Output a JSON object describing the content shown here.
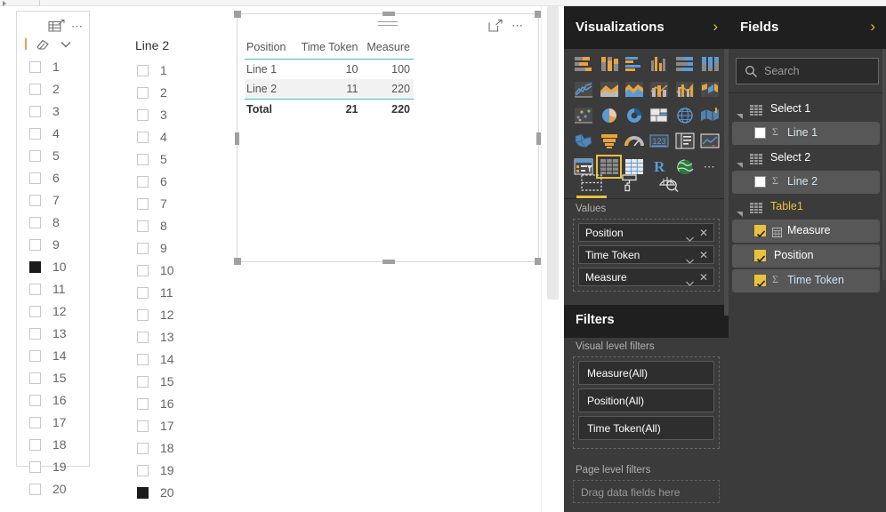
{
  "slicer1": {
    "icons": {
      "focus": "focus-mode-icon",
      "menu": "more-options-icon",
      "eraser": "clear-selections-icon",
      "chevron": "chevron-down-icon"
    },
    "items": [
      {
        "label": "1",
        "checked": false
      },
      {
        "label": "2",
        "checked": false
      },
      {
        "label": "3",
        "checked": false
      },
      {
        "label": "4",
        "checked": false
      },
      {
        "label": "5",
        "checked": false
      },
      {
        "label": "6",
        "checked": false
      },
      {
        "label": "7",
        "checked": false
      },
      {
        "label": "8",
        "checked": false
      },
      {
        "label": "9",
        "checked": false
      },
      {
        "label": "10",
        "checked": true
      },
      {
        "label": "11",
        "checked": false
      },
      {
        "label": "12",
        "checked": false
      },
      {
        "label": "13",
        "checked": false
      },
      {
        "label": "14",
        "checked": false
      },
      {
        "label": "15",
        "checked": false
      },
      {
        "label": "16",
        "checked": false
      },
      {
        "label": "17",
        "checked": false
      },
      {
        "label": "18",
        "checked": false
      },
      {
        "label": "19",
        "checked": false
      },
      {
        "label": "20",
        "checked": false
      }
    ]
  },
  "slicer2": {
    "title": "Line 2",
    "items": [
      {
        "label": "1",
        "checked": false
      },
      {
        "label": "2",
        "checked": false
      },
      {
        "label": "3",
        "checked": false
      },
      {
        "label": "4",
        "checked": false
      },
      {
        "label": "5",
        "checked": false
      },
      {
        "label": "6",
        "checked": false
      },
      {
        "label": "7",
        "checked": false
      },
      {
        "label": "8",
        "checked": false
      },
      {
        "label": "9",
        "checked": false
      },
      {
        "label": "10",
        "checked": false
      },
      {
        "label": "11",
        "checked": false
      },
      {
        "label": "12",
        "checked": false
      },
      {
        "label": "13",
        "checked": false
      },
      {
        "label": "14",
        "checked": false
      },
      {
        "label": "15",
        "checked": false
      },
      {
        "label": "16",
        "checked": false
      },
      {
        "label": "17",
        "checked": false
      },
      {
        "label": "18",
        "checked": false
      },
      {
        "label": "19",
        "checked": false
      },
      {
        "label": "20",
        "checked": true
      }
    ]
  },
  "visual": {
    "icons": {
      "grip": "drag-grip-icon",
      "focus": "focus-mode-icon",
      "menu": "more-options-icon"
    },
    "table": {
      "headers": [
        "Position",
        "Time Token",
        "Measure"
      ],
      "rows": [
        [
          "Line 1",
          "10",
          "100"
        ],
        [
          "Line 2",
          "11",
          "220"
        ]
      ],
      "total": [
        "Total",
        "21",
        "220"
      ]
    }
  },
  "visualizations": {
    "title": "Visualizations",
    "expand_icon": "chevron-right-icon",
    "icons": [
      [
        "stacked-bar-chart-icon",
        "stacked-column-chart-icon",
        "clustered-bar-chart-icon",
        "clustered-column-chart-icon",
        "hundred-percent-stacked-bar-icon",
        "hundred-percent-stacked-column-icon"
      ],
      [
        "line-chart-icon",
        "area-chart-icon",
        "stacked-area-chart-icon",
        "line-stacked-column-icon",
        "line-clustered-column-icon",
        "ribbon-chart-icon"
      ],
      [
        "scatter-chart-icon",
        "pie-chart-icon",
        "donut-chart-icon",
        "treemap-icon",
        "map-icon",
        "filled-map-icon"
      ],
      [
        "shape-map-icon",
        "funnel-chart-icon",
        "gauge-chart-icon",
        "card-icon",
        "multi-row-card-icon",
        "kpi-icon"
      ],
      [
        "slicer-icon",
        "table-icon",
        "matrix-icon",
        "r-script-visual-icon",
        "arcgis-map-icon",
        "more-visuals-icon"
      ]
    ],
    "selected_icon": "table-icon",
    "tabs": [
      {
        "name": "fields-tab",
        "icon": "fields-pane-icon",
        "active": true
      },
      {
        "name": "format-tab",
        "icon": "paint-roller-icon",
        "active": false
      },
      {
        "name": "analytics-tab",
        "icon": "analytics-magnifier-icon",
        "active": false
      }
    ],
    "values_label": "Values",
    "values": [
      {
        "label": "Position",
        "dropdown_icon": "chevron-down-icon",
        "remove_icon": "close-icon"
      },
      {
        "label": "Time Token",
        "dropdown_icon": "chevron-down-icon",
        "remove_icon": "close-icon"
      },
      {
        "label": "Measure",
        "dropdown_icon": "chevron-down-icon",
        "remove_icon": "close-icon"
      }
    ]
  },
  "filters": {
    "title": "Filters",
    "visual_level_label": "Visual level filters",
    "visual_level_items": [
      "Measure(All)",
      "Position(All)",
      "Time Token(All)"
    ],
    "page_level_label": "Page level filters",
    "page_level_placeholder": "Drag data fields here"
  },
  "fields": {
    "title": "Fields",
    "expand_icon": "chevron-right-icon",
    "search": {
      "placeholder": "Search",
      "value": "",
      "icon": "search-icon"
    },
    "tree": [
      {
        "table": "Select 1",
        "highlight": false,
        "table_icon": "table-icon",
        "expander_icon": "expander-open-icon",
        "fields": [
          {
            "label": "Line 1",
            "checked": false,
            "aggregate": "Σ",
            "field_icon": "checkbox-icon",
            "measure_icon": null
          }
        ]
      },
      {
        "table": "Select 2",
        "highlight": false,
        "table_icon": "table-icon",
        "expander_icon": "expander-open-icon",
        "fields": [
          {
            "label": "Line 2",
            "checked": false,
            "aggregate": "Σ",
            "field_icon": "checkbox-icon",
            "measure_icon": null
          }
        ]
      },
      {
        "table": "Table1",
        "highlight": true,
        "table_icon": "table-icon",
        "expander_icon": "expander-open-icon",
        "fields": [
          {
            "label": "Measure",
            "checked": true,
            "aggregate": null,
            "field_icon": "checkbox-icon",
            "measure_icon": "calculator-icon"
          },
          {
            "label": "Position",
            "checked": true,
            "aggregate": null,
            "field_icon": "checkbox-icon",
            "measure_icon": null
          },
          {
            "label": "Time Token",
            "checked": true,
            "aggregate": "Σ",
            "field_icon": "checkbox-icon",
            "measure_icon": null
          }
        ]
      }
    ]
  },
  "colors": {
    "accent_yellow": "#e8c23d",
    "panel_bg": "#3b3b3b",
    "panel_header_bg": "#1f1f1f",
    "table_accent": "#3ec0c0",
    "icon_orange": "#e8a33d",
    "icon_blue": "#5b9bd5"
  }
}
